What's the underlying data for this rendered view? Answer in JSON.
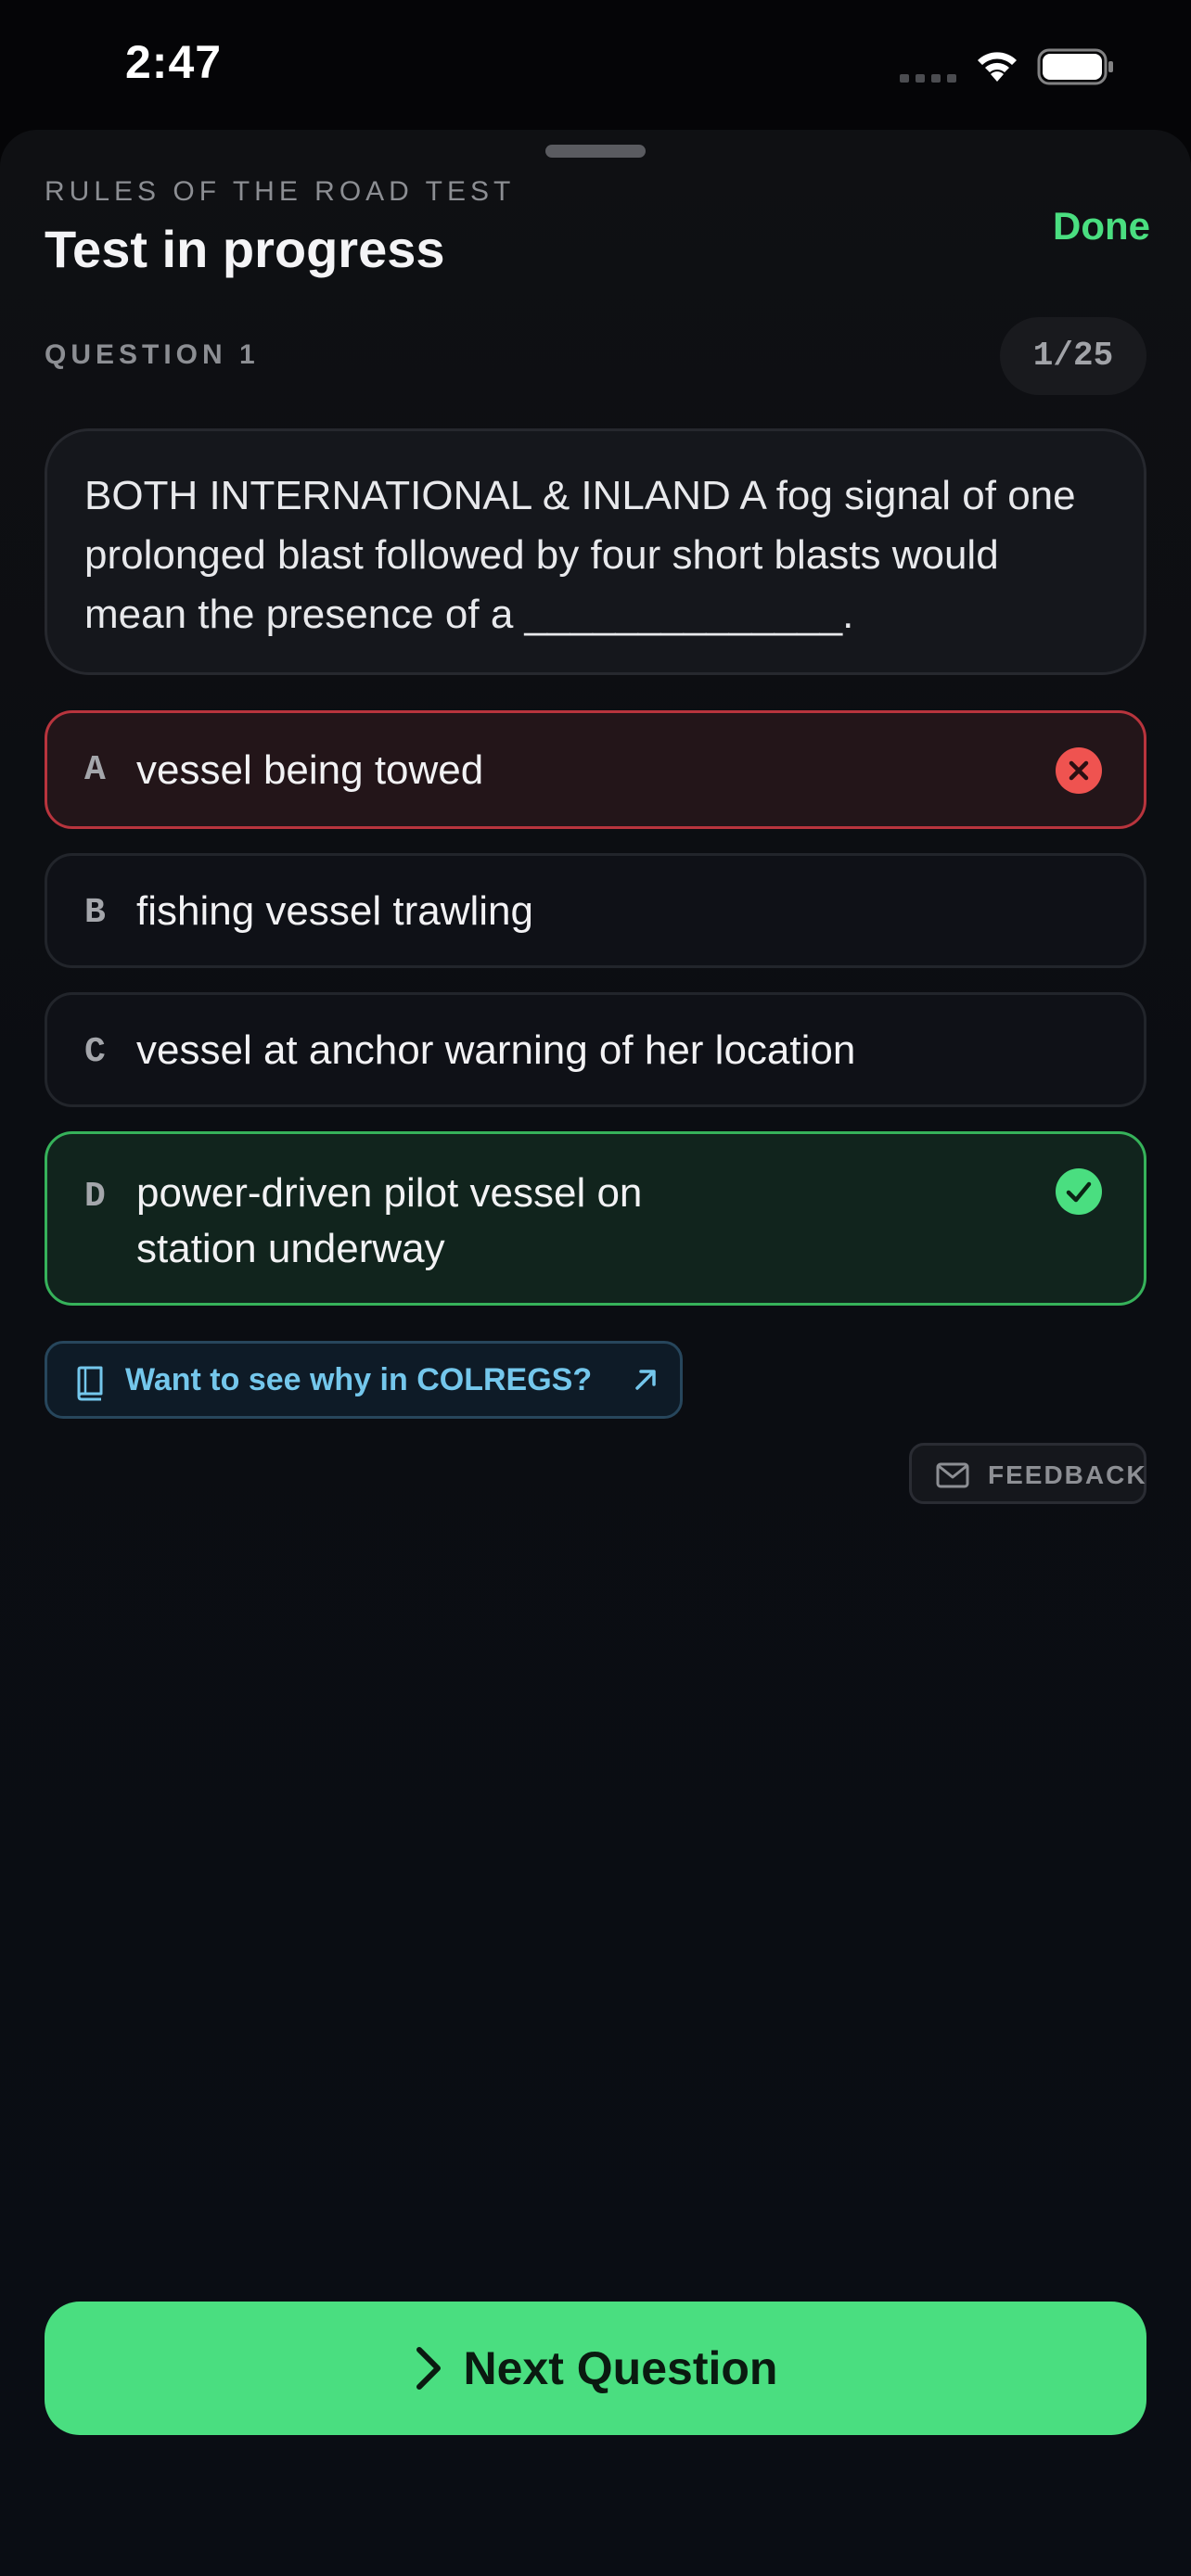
{
  "status_bar": {
    "time": "2:47"
  },
  "sheet": {
    "eyebrow": "RULES OF THE ROAD TEST",
    "title": "Test in progress",
    "done_label": "Done"
  },
  "question": {
    "label": "QUESTION 1",
    "progress": "1/25",
    "text": "BOTH INTERNATIONAL & INLAND A fog signal of one prolonged blast followed by four short blasts would mean the presence of a ______________."
  },
  "answers": [
    {
      "letter": "A",
      "text": "vessel being towed",
      "state": "wrong",
      "status_icon": "close-icon"
    },
    {
      "letter": "B",
      "text": "fishing vessel trawling",
      "state": "neutral"
    },
    {
      "letter": "C",
      "text": "vessel at anchor warning of her location",
      "state": "neutral"
    },
    {
      "letter": "D",
      "text": "power-driven pilot vessel on station underway",
      "state": "correct",
      "status_icon": "check-icon"
    }
  ],
  "colregs_link": {
    "label": "Want to see why in COLREGS?",
    "icon": "book-icon",
    "trailing_icon": "arrow-up-right-icon"
  },
  "feedback": {
    "label": "FEEDBACK",
    "icon": "mail-icon"
  },
  "next_button": {
    "label": "Next Question",
    "icon": "chevron-right-icon"
  },
  "colors": {
    "accent_green": "#4ade80",
    "wrong_red": "#ef5350",
    "link_blue": "#74c7ec",
    "background": "#0a0d14"
  }
}
